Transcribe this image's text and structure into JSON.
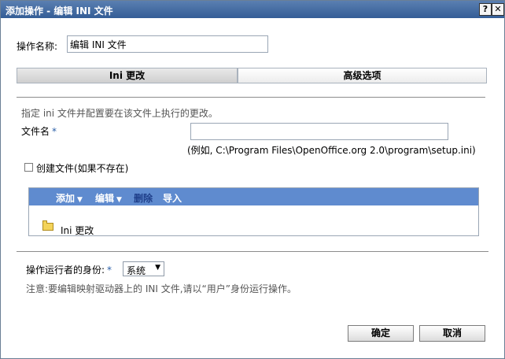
{
  "window": {
    "title": "添加操作 - 编辑 INI 文件",
    "help_glyph": "?",
    "close_glyph": "✕"
  },
  "action_name": {
    "label": "操作名称:",
    "value": "编辑 INI 文件"
  },
  "tabs": [
    {
      "label": "Ini 更改",
      "selected": true
    },
    {
      "label": "高级选项",
      "selected": false
    }
  ],
  "ini_tab": {
    "description": "指定 ini 文件并配置要在该文件上执行的更改。",
    "file_name_label": "文件名",
    "required_marker": "*",
    "file_name_value": "",
    "example_hint": "(例如, C:\\Program Files\\OpenOffice.org 2.0\\program\\setup.ini)",
    "create_file_label": "创建文件(如果不存在)",
    "create_file_checked": false
  },
  "changes_panel": {
    "toolbar": {
      "add": "添加",
      "edit": "编辑",
      "delete": "删除",
      "import": "导入",
      "dropdown_glyph": "▼"
    },
    "items": [
      {
        "icon": "folder-icon",
        "label": "Ini 更改"
      }
    ]
  },
  "run_as": {
    "label": "操作运行者的身份:",
    "required_marker": "*",
    "selected": "系统",
    "dropdown_glyph": "▼",
    "note": "注意:要编辑映射驱动器上的 INI 文件,请以“用户”身份运行操作。"
  },
  "footer": {
    "ok": "确定",
    "cancel": "取消"
  },
  "colors": {
    "titlebar": "#345d96",
    "toolbar": "#5f8bcf",
    "required": "#2a5fa8"
  }
}
